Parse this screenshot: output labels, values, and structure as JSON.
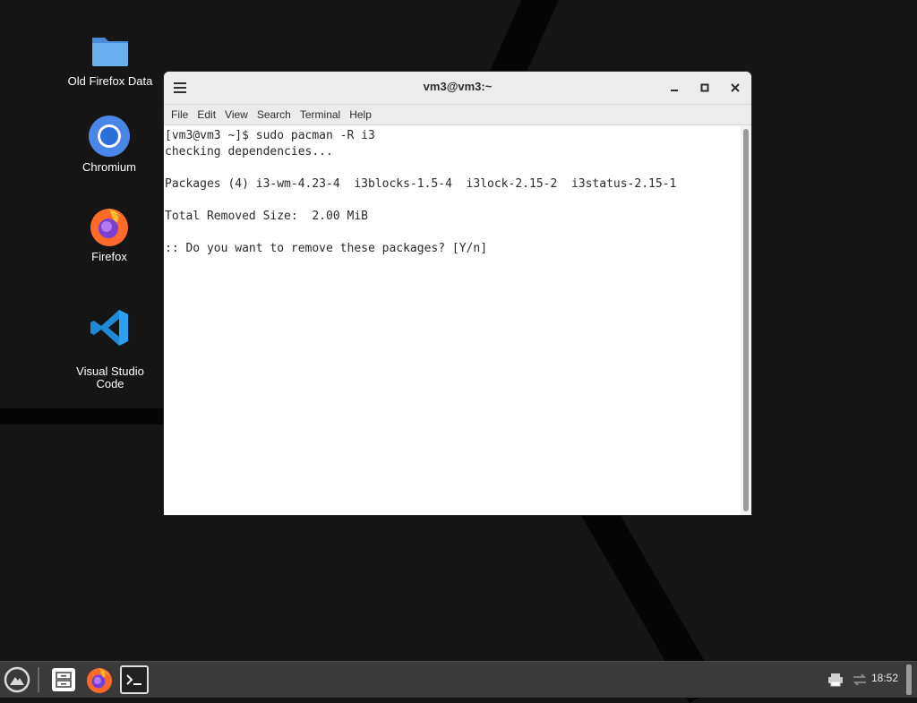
{
  "desktop": {
    "icons": [
      {
        "label": "Old Firefox Data",
        "icon": "folder-icon"
      },
      {
        "label": "Chromium",
        "icon": "chromium-icon"
      },
      {
        "label": "Firefox",
        "icon": "firefox-icon"
      },
      {
        "label": "Visual Studio\nCode",
        "icon": "vscode-icon"
      }
    ]
  },
  "window": {
    "title": "vm3@vm3:~",
    "menu": [
      "File",
      "Edit",
      "View",
      "Search",
      "Terminal",
      "Help"
    ],
    "terminal_lines": [
      "[vm3@vm3 ~]$ sudo pacman -R i3",
      "checking dependencies...",
      "",
      "Packages (4) i3-wm-4.23-4  i3blocks-1.5-4  i3lock-2.15-2  i3status-2.15-1",
      "",
      "Total Removed Size:  2.00 MiB",
      "",
      ":: Do you want to remove these packages? [Y/n]"
    ]
  },
  "taskbar": {
    "items": [
      "start-menu-icon",
      "file-manager-icon",
      "firefox-icon",
      "terminal-icon"
    ],
    "tray": [
      "printer-icon",
      "network-icon"
    ],
    "clock": "18:52"
  },
  "colors": {
    "desktop_bg": "#151515",
    "taskbar_bg": "#3a3a3a",
    "window_chrome": "#ececec",
    "folder_blue": "#5a9de6",
    "vscode_blue": "#1e8ad6"
  }
}
